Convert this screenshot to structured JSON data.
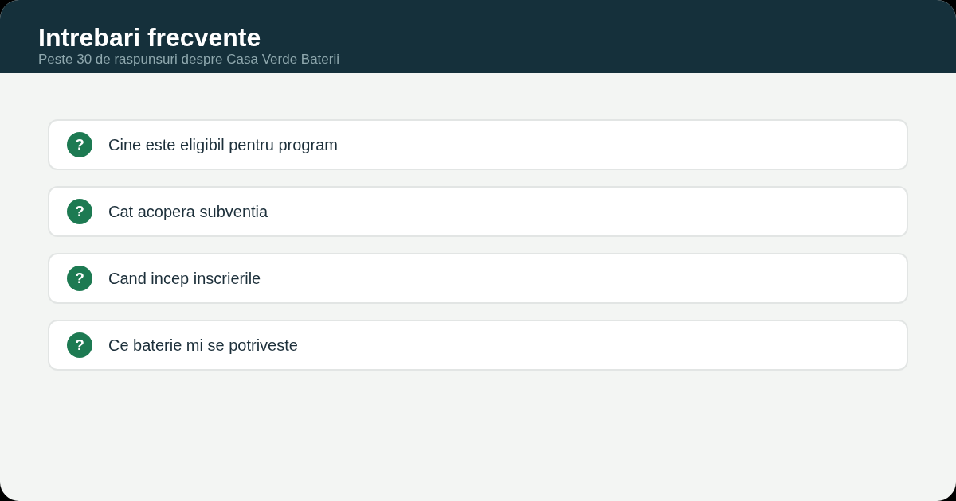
{
  "header": {
    "title": "Intrebari frecvente",
    "subtitle": "Peste 30 de raspunsuri despre Casa Verde Baterii"
  },
  "faq": [
    {
      "question": "Cine este eligibil pentru program",
      "icon": "?"
    },
    {
      "question": "Cat acopera subventia",
      "icon": "?"
    },
    {
      "question": "Cand incep inscrierile",
      "icon": "?"
    },
    {
      "question": "Ce baterie mi se potriveste",
      "icon": "?"
    }
  ]
}
